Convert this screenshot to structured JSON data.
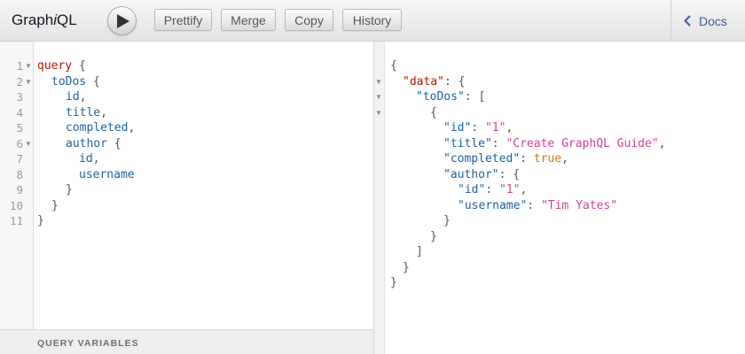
{
  "app": {
    "title_prefix": "Graph",
    "title_italic": "i",
    "title_suffix": "QL"
  },
  "toolbar": {
    "buttons": [
      {
        "label": "Prettify"
      },
      {
        "label": "Merge"
      },
      {
        "label": "Copy"
      },
      {
        "label": "History"
      }
    ],
    "run_icon": "play-icon",
    "docs_label": "Docs",
    "docs_icon": "chevron-left-icon"
  },
  "editor": {
    "line_numbers": [
      "1",
      "2",
      "3",
      "4",
      "5",
      "6",
      "7",
      "8",
      "9",
      "10",
      "11"
    ],
    "query": {
      "keyword": "query",
      "root_field": "toDos",
      "fields": [
        "id",
        "title",
        "completed"
      ],
      "nested_field": "author",
      "nested_fields": [
        "id",
        "username"
      ]
    },
    "variables_label": "QUERY VARIABLES"
  },
  "result": {
    "data_key": "data",
    "list_key": "toDos",
    "item": {
      "id_key": "id",
      "id_value": "\"1\"",
      "title_key": "title",
      "title_value": "\"Create GraphQL Guide\"",
      "completed_key": "completed",
      "completed_value": "true",
      "author_key": "author",
      "author_id_key": "id",
      "author_id_value": "\"1\"",
      "username_key": "username",
      "username_value": "\"Tim Yates\""
    }
  },
  "colors": {
    "keyword": "#b11a04",
    "field": "#1f61a0",
    "string": "#d64292",
    "boolean": "#d47509",
    "link": "#3b5998"
  }
}
